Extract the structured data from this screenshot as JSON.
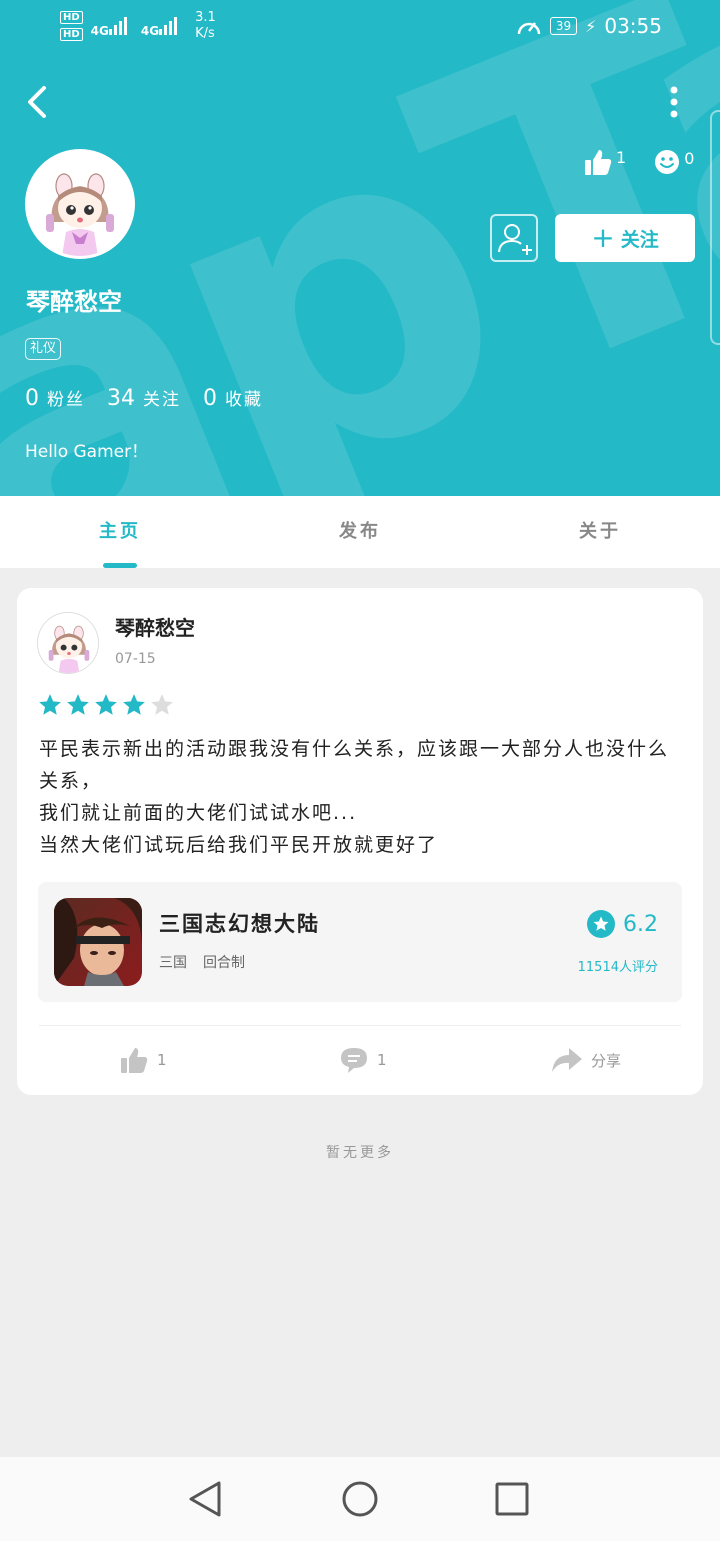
{
  "status_bar": {
    "hd1": "HD",
    "hd2": "HD",
    "net1": "4G",
    "net2": "4G",
    "speed_value": "3.1",
    "speed_unit": "K/s",
    "battery": "39",
    "time": "03:55"
  },
  "profile": {
    "likes": "1",
    "smiles": "0",
    "follow_label": "关注",
    "name": "琴醉愁空",
    "badge": "礼仪",
    "fans_count": "0",
    "fans_label": "粉丝",
    "following_count": "34",
    "following_label": "关注",
    "favorites_count": "0",
    "favorites_label": "收藏",
    "bio": "Hello Gamer！"
  },
  "tabs": [
    {
      "label": "主页",
      "active": true
    },
    {
      "label": "发布",
      "active": false
    },
    {
      "label": "关于",
      "active": false
    }
  ],
  "post": {
    "author": "琴醉愁空",
    "date": "07-15",
    "rating": 4,
    "max_rating": 5,
    "lines": [
      "平民表示新出的活动跟我没有什么关系，应该跟一大部分人也没什么关系，",
      "我们就让前面的大佬们试试水吧...",
      "当然大佬们试玩后给我们平民开放就更好了"
    ],
    "game": {
      "title": "三国志幻想大陆",
      "tag1": "三国",
      "tag2": "回合制",
      "score": "6.2",
      "rating_count": "11514人评分"
    },
    "likes": "1",
    "comments": "1",
    "share_label": "分享"
  },
  "footer_text": "暂无更多",
  "colors": {
    "accent": "#24b9c7",
    "star_off": "#dddddd"
  }
}
